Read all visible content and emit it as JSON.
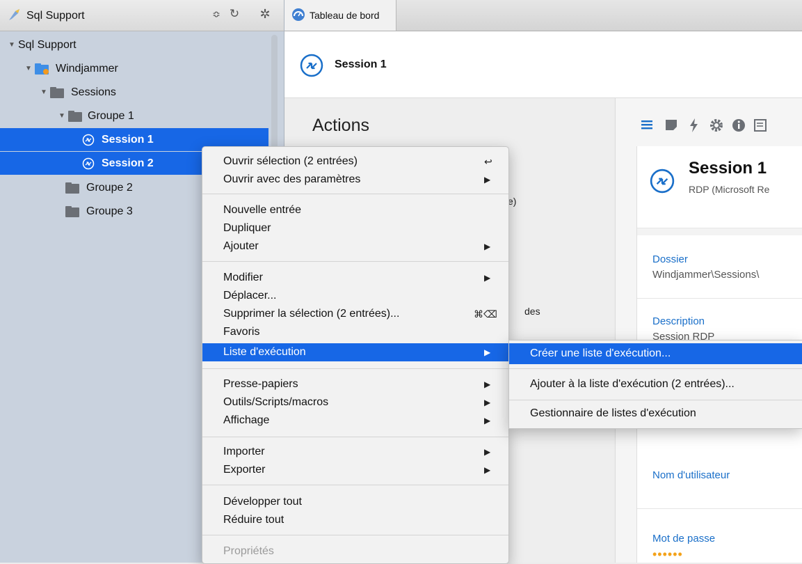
{
  "sidebar": {
    "title": "Sql Support",
    "controls": {
      "stepper": "≎",
      "refresh": "↻",
      "settings": "✲"
    },
    "tree": [
      {
        "label": "Sql Support",
        "expanded": true
      },
      {
        "label": "Windjammer",
        "expanded": true
      },
      {
        "label": "Sessions",
        "expanded": true
      },
      {
        "label": "Groupe 1",
        "expanded": true
      },
      {
        "label": "Session 1",
        "selected": true
      },
      {
        "label": "Session 2",
        "selected": true
      },
      {
        "label": "Groupe 2"
      },
      {
        "label": "Groupe 3"
      }
    ]
  },
  "tabs": [
    {
      "label": "Tableau de bord"
    }
  ],
  "session_header": {
    "title": "Session 1"
  },
  "actions": {
    "title": "Actions",
    "peek_1": "e)",
    "peek_2": "des"
  },
  "details": {
    "title": "Session 1",
    "subtitle": "RDP (Microsoft Re",
    "fields": [
      {
        "label": "Dossier",
        "value": "Windjammer\\Sessions\\"
      },
      {
        "label": "Description",
        "value": "Session RDP"
      },
      {
        "label": "Nom d'utilisateur",
        "value": ""
      },
      {
        "label": "Mot de passe",
        "value": "••••••"
      }
    ]
  },
  "context_menu": {
    "items": [
      {
        "label": "Ouvrir sélection (2 entrées)",
        "shortcut": "↩"
      },
      {
        "label": "Ouvrir avec des paramètres",
        "submenu": true
      },
      {
        "label": "Nouvelle entrée"
      },
      {
        "label": "Dupliquer"
      },
      {
        "label": "Ajouter",
        "submenu": true
      },
      {
        "label": "Modifier",
        "submenu": true
      },
      {
        "label": "Déplacer..."
      },
      {
        "label": "Supprimer la sélection (2 entrées)...",
        "shortcut": "⌘⌫"
      },
      {
        "label": "Favoris"
      },
      {
        "label": "Liste d'exécution",
        "submenu": true,
        "highlighted": true
      },
      {
        "label": "Presse-papiers",
        "submenu": true
      },
      {
        "label": "Outils/Scripts/macros",
        "submenu": true
      },
      {
        "label": "Affichage",
        "submenu": true
      },
      {
        "label": "Importer",
        "submenu": true
      },
      {
        "label": "Exporter",
        "submenu": true
      },
      {
        "label": "Développer tout"
      },
      {
        "label": "Réduire tout"
      },
      {
        "label": "Propriétés",
        "disabled": true
      }
    ]
  },
  "submenu": {
    "items": [
      {
        "label": "Créer une liste d'exécution...",
        "highlighted": true
      },
      {
        "label": "Ajouter à la liste d'exécution (2 entrées)..."
      },
      {
        "label": "Gestionnaire de listes d'exécution"
      }
    ]
  },
  "colors": {
    "accent": "#1767e6",
    "link": "#1a6fc9",
    "password_dots": "#f3a21a"
  }
}
